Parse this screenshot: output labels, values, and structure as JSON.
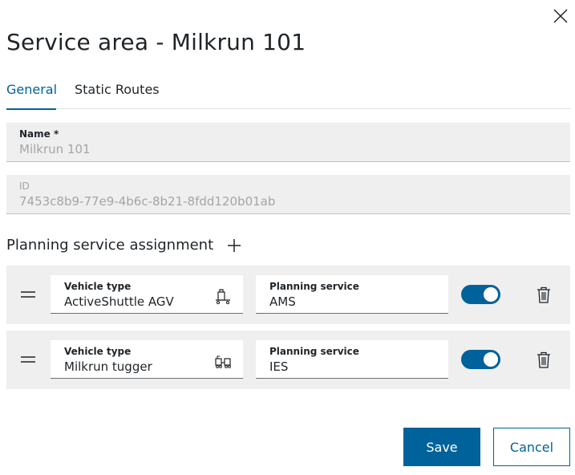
{
  "dialog": {
    "title": "Service area - Milkrun 101",
    "close_icon": "close-icon"
  },
  "tabs": [
    {
      "label": "General",
      "active": true
    },
    {
      "label": "Static Routes",
      "active": false
    }
  ],
  "fields": {
    "name": {
      "label": "Name *",
      "value": "Milkrun 101"
    },
    "id": {
      "label": "ID",
      "value": "7453c8b9-77e9-4b6c-8b21-8fdd120b01ab"
    }
  },
  "assignment": {
    "title": "Planning service assignment",
    "add_icon": "plus-icon",
    "rows": [
      {
        "vehicle_label": "Vehicle type",
        "vehicle_value": "ActiveShuttle AGV",
        "vehicle_icon": "agv-icon",
        "planning_label": "Planning service",
        "planning_value": "AMS",
        "enabled": true
      },
      {
        "vehicle_label": "Vehicle type",
        "vehicle_value": "Milkrun tugger",
        "vehicle_icon": "tugger-icon",
        "planning_label": "Planning service",
        "planning_value": "IES",
        "enabled": true
      }
    ]
  },
  "actions": {
    "save_label": "Save",
    "cancel_label": "Cancel"
  },
  "colors": {
    "accent": "#00629a",
    "field_bg": "#efeff0"
  }
}
